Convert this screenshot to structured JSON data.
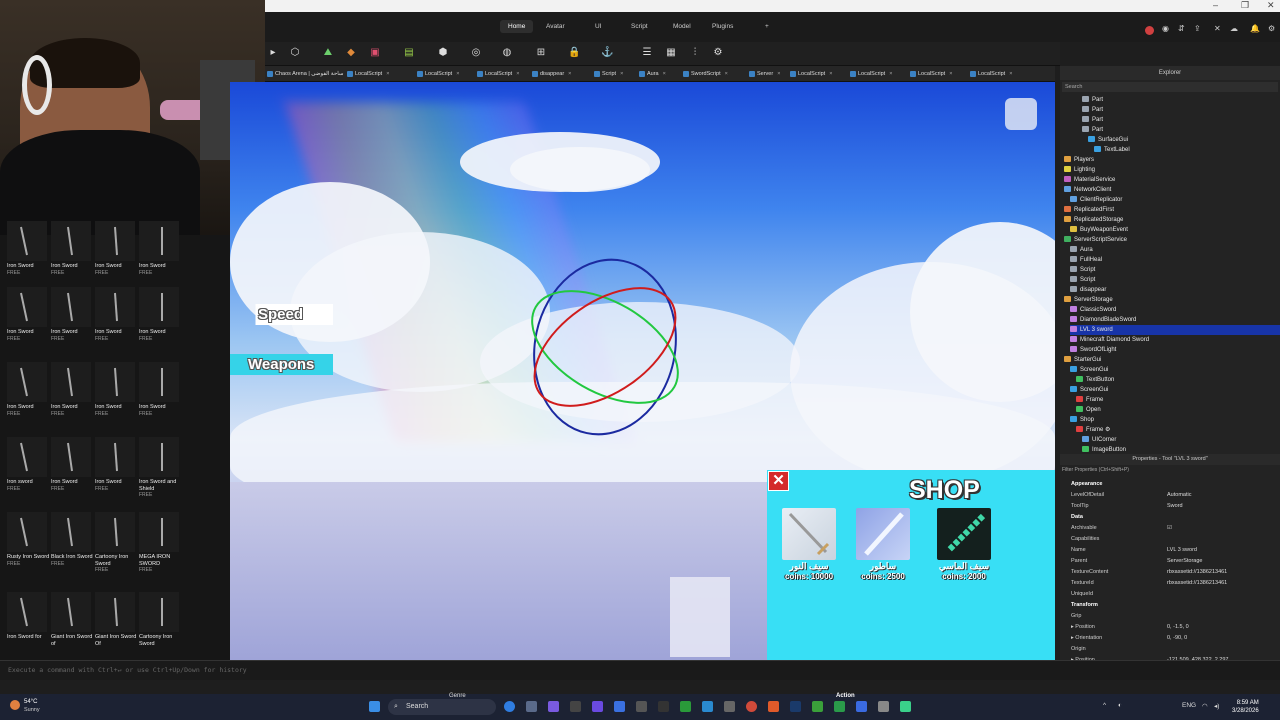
{
  "menu": {
    "tabs": [
      "Home",
      "Avatar",
      "UI",
      "Script",
      "Model",
      "Plugins",
      "+"
    ],
    "active": "Home"
  },
  "script_tabs": [
    {
      "label": "Chaos Arena | ساحة الفوضى"
    },
    {
      "label": "LocalScript"
    },
    {
      "label": "LocalScript"
    },
    {
      "label": "LocalScript"
    },
    {
      "label": "disappear"
    },
    {
      "label": "Script"
    },
    {
      "label": "Aura"
    },
    {
      "label": "SwordScript"
    },
    {
      "label": "Server"
    },
    {
      "label": "LocalScript"
    },
    {
      "label": "LocalScript"
    },
    {
      "label": "LocalScript"
    },
    {
      "label": "LocalScript"
    }
  ],
  "viewport": {
    "speed_label": "Speed",
    "weapons_label": "Weapons"
  },
  "shop": {
    "title": "SHOP",
    "close": "✕",
    "items": [
      {
        "name": "سيف النور",
        "price": "coins: 10000"
      },
      {
        "name": "ساطور",
        "price": "coins: 2500"
      },
      {
        "name": "سيف الماسي",
        "price": "coins: 2000"
      }
    ]
  },
  "toolbox": {
    "items": [
      {
        "name": "Iron Sword",
        "price": "FREE"
      },
      {
        "name": "Iron Sword",
        "price": "FREE"
      },
      {
        "name": "Iron Sword",
        "price": "FREE"
      },
      {
        "name": "Iron Sword",
        "price": "FREE"
      },
      {
        "name": "Iron Sword",
        "price": "FREE"
      },
      {
        "name": "Iron Sword",
        "price": "FREE"
      },
      {
        "name": "Iron Sword",
        "price": "FREE"
      },
      {
        "name": "Iron Sword",
        "price": "FREE"
      },
      {
        "name": "Iron Sword",
        "price": "FREE"
      },
      {
        "name": "Iron Sword",
        "price": "FREE"
      },
      {
        "name": "Iron Sword",
        "price": "FREE"
      },
      {
        "name": "Iron Sword",
        "price": "FREE"
      },
      {
        "name": "Iron sword",
        "price": "FREE"
      },
      {
        "name": "Iron Sword",
        "price": "FREE"
      },
      {
        "name": "Iron Sword",
        "price": "FREE"
      },
      {
        "name": "Iron Sword and Shield",
        "price": "FREE"
      },
      {
        "name": "Rusty Iron Sword",
        "price": "FREE"
      },
      {
        "name": "Black Iron Sword",
        "price": "FREE"
      },
      {
        "name": "Cartoony Iron Sword",
        "price": "FREE"
      },
      {
        "name": "MEGA IRON SWORD",
        "price": "FREE"
      },
      {
        "name": "Iron Sword for",
        "price": ""
      },
      {
        "name": "Giant Iron Sword of",
        "price": ""
      },
      {
        "name": "Giant Iron Sword Of",
        "price": ""
      },
      {
        "name": "Cartoony Iron Sword",
        "price": ""
      }
    ]
  },
  "explorer": {
    "title": "Explorer",
    "search_placeholder": "Search",
    "items": [
      {
        "label": "Part",
        "depth": 3,
        "color": "#9aa4b0"
      },
      {
        "label": "Part",
        "depth": 3,
        "color": "#9aa4b0"
      },
      {
        "label": "Part",
        "depth": 3,
        "color": "#9aa4b0"
      },
      {
        "label": "Part",
        "depth": 3,
        "color": "#9aa4b0"
      },
      {
        "label": "SurfaceGui",
        "depth": 4,
        "color": "#3aa0e0"
      },
      {
        "label": "TextLabel",
        "depth": 5,
        "color": "#3aa0e0"
      },
      {
        "label": "Players",
        "depth": 0,
        "color": "#e0a040"
      },
      {
        "label": "Lighting",
        "depth": 0,
        "color": "#e0d040"
      },
      {
        "label": "MaterialService",
        "depth": 0,
        "color": "#c060c0"
      },
      {
        "label": "NetworkClient",
        "depth": 0,
        "color": "#60a0e0"
      },
      {
        "label": "ClientReplicator",
        "depth": 1,
        "color": "#60a0e0"
      },
      {
        "label": "ReplicatedFirst",
        "depth": 0,
        "color": "#e07040"
      },
      {
        "label": "ReplicatedStorage",
        "depth": 0,
        "color": "#e0a040"
      },
      {
        "label": "BuyWeaponEvent",
        "depth": 1,
        "color": "#e0c040"
      },
      {
        "label": "ServerScriptService",
        "depth": 0,
        "color": "#40b060"
      },
      {
        "label": "Aura",
        "depth": 1,
        "color": "#9aa4b0"
      },
      {
        "label": "FullHeal",
        "depth": 1,
        "color": "#9aa4b0"
      },
      {
        "label": "Script",
        "depth": 1,
        "color": "#9aa4b0"
      },
      {
        "label": "Script",
        "depth": 1,
        "color": "#9aa4b0"
      },
      {
        "label": "disappear",
        "depth": 1,
        "color": "#9aa4b0"
      },
      {
        "label": "ServerStorage",
        "depth": 0,
        "color": "#e0a040"
      },
      {
        "label": "ClassicSword",
        "depth": 1,
        "color": "#c080e0"
      },
      {
        "label": "DiamondBladeSword",
        "depth": 1,
        "color": "#c080e0"
      },
      {
        "label": "LVL 3 sword",
        "depth": 1,
        "color": "#c080e0",
        "selected": true
      },
      {
        "label": "Minecraft Diamond Sword",
        "depth": 1,
        "color": "#c080e0"
      },
      {
        "label": "SwordOfLight",
        "depth": 1,
        "color": "#c080e0"
      },
      {
        "label": "StarterGui",
        "depth": 0,
        "color": "#e0a040"
      },
      {
        "label": "ScreenGui",
        "depth": 1,
        "color": "#3aa0e0"
      },
      {
        "label": "TextButton",
        "depth": 2,
        "color": "#40c060"
      },
      {
        "label": "ScreenGui",
        "depth": 1,
        "color": "#3aa0e0"
      },
      {
        "label": "Frame",
        "depth": 2,
        "color": "#e04040"
      },
      {
        "label": "Open",
        "depth": 2,
        "color": "#40c060"
      },
      {
        "label": "Shop",
        "depth": 1,
        "color": "#3aa0e0"
      },
      {
        "label": "Frame ⚙",
        "depth": 2,
        "color": "#e04040"
      },
      {
        "label": "UICorner",
        "depth": 3,
        "color": "#60a0e0"
      },
      {
        "label": "ImageButton",
        "depth": 3,
        "color": "#40c060"
      }
    ]
  },
  "properties": {
    "title": "Properties - Tool \"LVL 3 sword\"",
    "filter": "Filter Properties (Ctrl+Shift+P)",
    "rows": [
      {
        "k": "Appearance",
        "v": "",
        "section": true
      },
      {
        "k": "LevelOfDetail",
        "v": "Automatic"
      },
      {
        "k": "ToolTip",
        "v": "Sword"
      },
      {
        "k": "Data",
        "v": "",
        "section": true
      },
      {
        "k": "Archivable",
        "v": "☑"
      },
      {
        "k": "Capabilities",
        "v": ""
      },
      {
        "k": "Name",
        "v": "LVL 3 sword"
      },
      {
        "k": "Parent",
        "v": "ServerStorage"
      },
      {
        "k": "TextureContent",
        "v": "rbxassetid://1386213461"
      },
      {
        "k": "TextureId",
        "v": "rbxassetid://1386213461"
      },
      {
        "k": "UniqueId",
        "v": ""
      },
      {
        "k": "Transform",
        "v": "",
        "section": true
      },
      {
        "k": "Grip",
        "v": ""
      },
      {
        "k": "▸ Position",
        "v": "0, -1.5, 0"
      },
      {
        "k": "▸ Orientation",
        "v": "0, -90, 0"
      },
      {
        "k": "Origin",
        "v": ""
      },
      {
        "k": "▸ Position",
        "v": "-121.509, 428.322, 2.297"
      }
    ]
  },
  "command_bar": {
    "placeholder": "Execute a command with Ctrl+↵ or use Ctrl+Up/Down for history"
  },
  "taskbar": {
    "temp": "54°C",
    "condition": "Sunny",
    "search": "Search",
    "genre": "Genre",
    "action": "Action",
    "lang": "ENG",
    "time": "8:59 AM",
    "date": "3/28/2026"
  }
}
